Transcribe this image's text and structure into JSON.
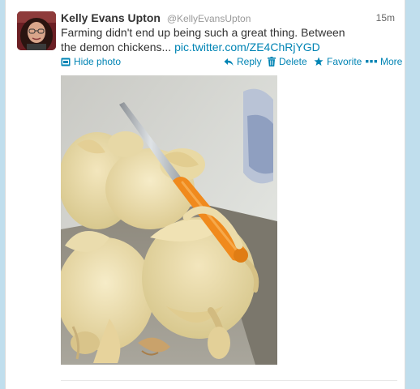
{
  "tweet": {
    "fullname": "Kelly Evans Upton",
    "screenname": "@KellyEvansUpton",
    "timestamp": "15m",
    "text_before": "Farming didn't end up being such a great thing. Between the demon chickens...",
    "link": "pic.twitter.com/ZE4ChRjYGD"
  },
  "actions": {
    "hide_photo": "Hide photo",
    "reply": "Reply",
    "delete": "Delete",
    "favorite": "Favorite",
    "more": "More"
  },
  "colors": {
    "link": "#0084b4",
    "page_background": "#c0deed"
  },
  "icons": {
    "hide_photo": "photo-icon",
    "reply": "reply-arrow-icon",
    "delete": "trash-icon",
    "favorite": "star-icon",
    "more": "ellipsis-icon"
  }
}
